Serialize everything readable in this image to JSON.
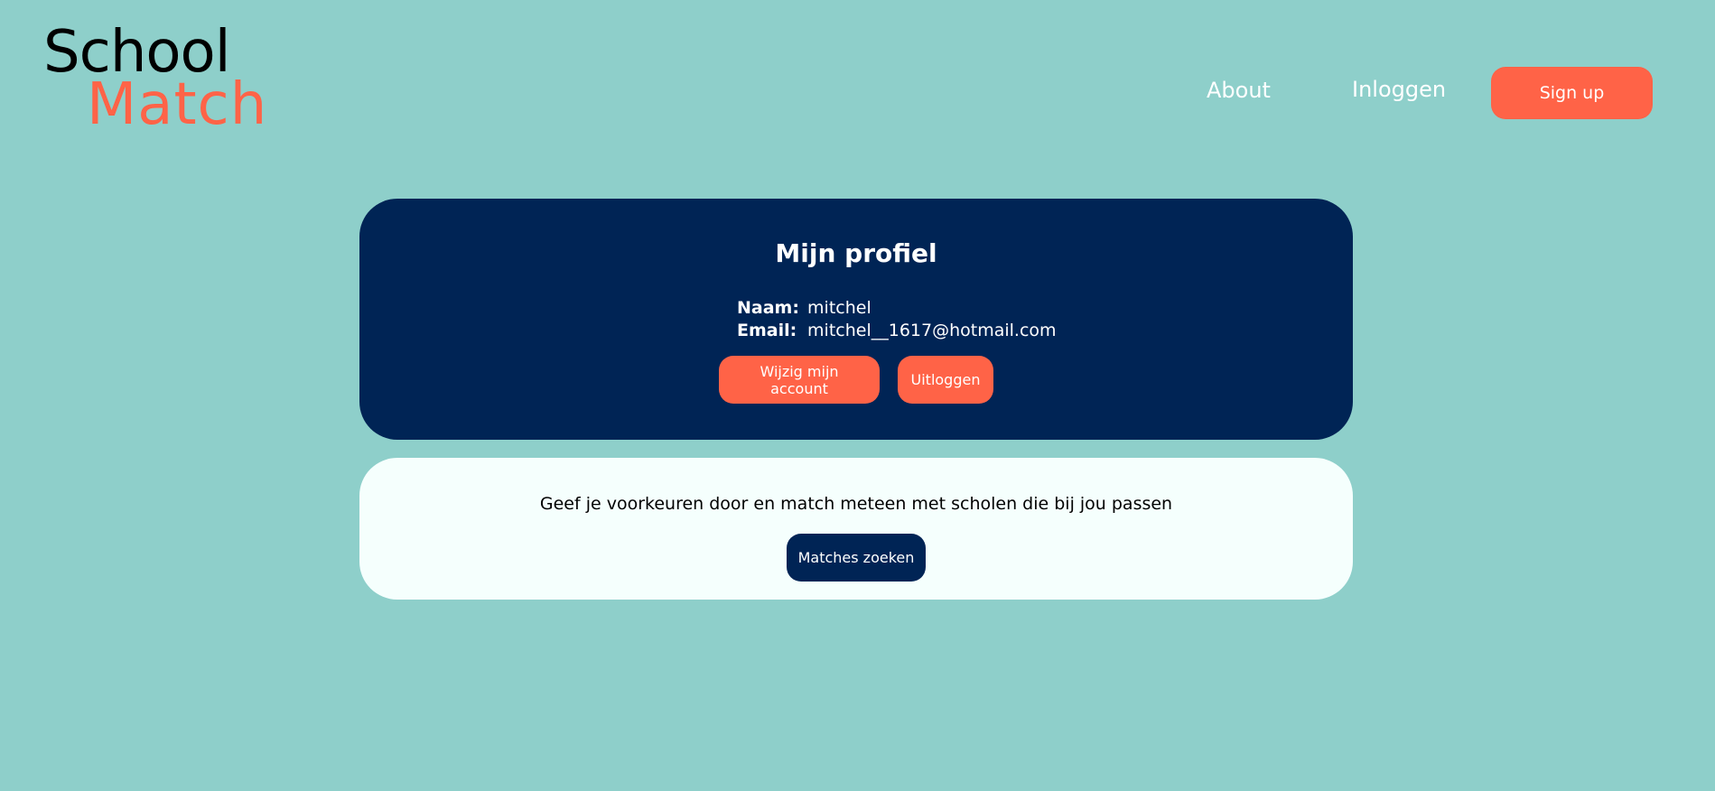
{
  "header": {
    "logo": {
      "line1": "School",
      "line2": "Match",
      "color_line1": "#000000",
      "color_line2": "#ff6347"
    },
    "nav": {
      "about": "About",
      "login": "Inloggen",
      "signup": "Sign up"
    }
  },
  "profile": {
    "title": "Mijn profiel",
    "name_label": "Naam:",
    "name_value": "mitchel",
    "email_label": "Email:",
    "email_value": "mitchel__1617@hotmail.com",
    "edit_button": "Wijzig mijn account",
    "logout_button": "Uitloggen"
  },
  "matching": {
    "description": "Geef je voorkeuren door en match meteen met scholen die bij jou passen",
    "button": "Matches zoeken"
  },
  "colors": {
    "background": "#8ecfca",
    "navy": "#002455",
    "coral": "#ff6347",
    "card_light": "#f5fffd"
  }
}
